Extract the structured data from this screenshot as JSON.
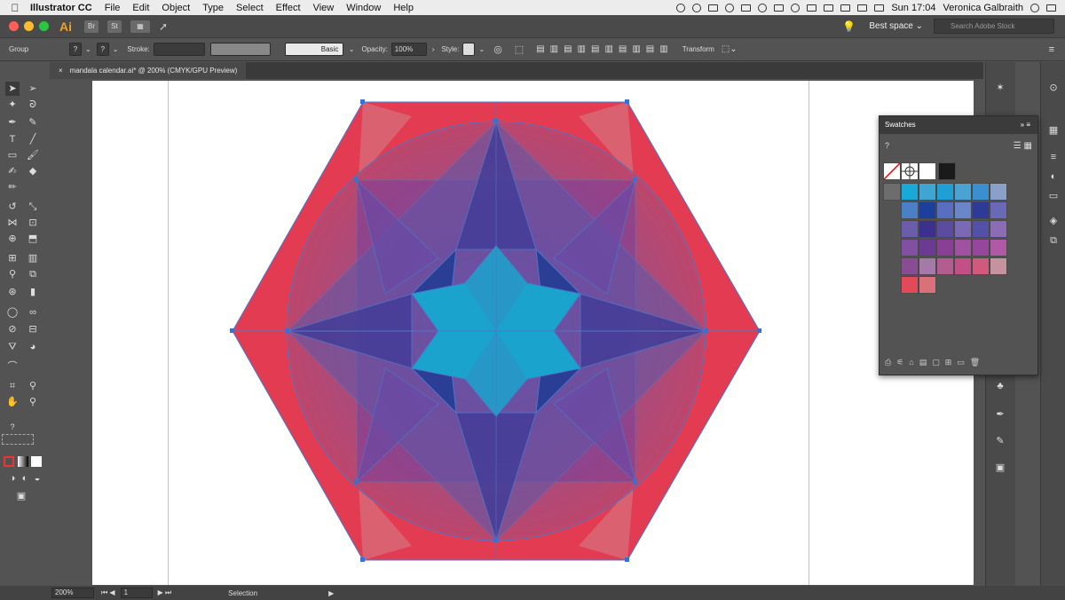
{
  "menubar": {
    "app_name": "Illustrator CC",
    "menus": [
      "File",
      "Edit",
      "Object",
      "Type",
      "Select",
      "Effect",
      "View",
      "Window",
      "Help"
    ],
    "clock": "Sun 17:04",
    "user": "Veronica Galbraith"
  },
  "appbar": {
    "logo": "Ai",
    "br_label": "Br",
    "st_label": "St",
    "workspace": "Best space",
    "search_placeholder": "Search Adobe Stock"
  },
  "controlbar": {
    "selection_type": "Group",
    "stroke_label": "Stroke:",
    "brush_label": "Basic",
    "opacity_label": "Opacity:",
    "opacity_value": "100%",
    "style_label": "Style:",
    "transform_label": "Transform"
  },
  "document": {
    "tab_title": "mandala calendar.ai* @ 200% (CMYK/GPU Preview)",
    "close_glyph": "×"
  },
  "swatches": {
    "title": "Swatches",
    "colors": [
      [
        "#19a9d9",
        "#3fa6d4",
        "#1e9fd6",
        "#4aa3d2",
        "#3b8fd0",
        "#8aa0c8"
      ],
      [
        "#4b7fc6",
        "#1b3f9c",
        "#5a6ec0",
        "#6a85c8",
        "#2e3b96",
        "#6a69b7"
      ],
      [
        "#6c5dab",
        "#3c2f8f",
        "#5b4ca2",
        "#7a69b4",
        "#5350a7",
        "#8a6db5"
      ],
      [
        "#8250a3",
        "#6b3a93",
        "#8a3f97",
        "#a052a0",
        "#96479b",
        "#b05aa6"
      ],
      [
        "#8a4c92",
        "#a37aa8",
        "#b25c8f",
        "#c24f86",
        "#d05a7d",
        "#c5929e"
      ],
      [
        "#e24a59",
        "#d9707a"
      ]
    ]
  },
  "status": {
    "zoom": "200%",
    "artboard": "1",
    "tool": "Selection"
  },
  "accent_colors": {
    "hexagon": "#e23b52",
    "teal_center": "#1aa3cc",
    "guide": "#7fe0e0"
  }
}
